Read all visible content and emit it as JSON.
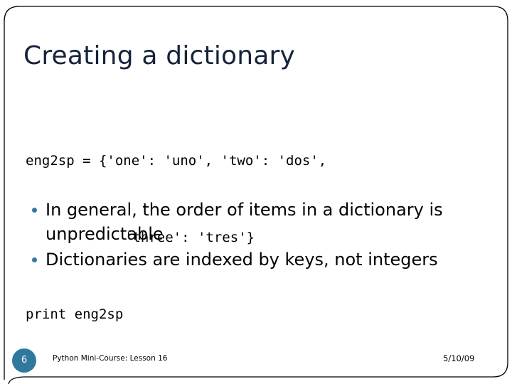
{
  "slide": {
    "title": "Creating a dictionary",
    "code_lines": [
      {
        "text": "eng2sp = {'one': 'uno', 'two': 'dos',",
        "indent": false
      },
      {
        "text": "'three': 'tres'}",
        "indent": true
      },
      {
        "text": "print eng2sp",
        "indent": false
      }
    ],
    "bullets": [
      "In general, the order of items in a dictionary is unpredictable",
      "Dictionaries are indexed by keys, not integers"
    ],
    "footer": {
      "slide_number": "6",
      "course_label": "Python Mini-Course: Lesson 16",
      "date": "5/10/09"
    },
    "colors": {
      "title": "#16233a",
      "accent": "#31789f",
      "body": "#000000",
      "frame": "#000000",
      "background": "#ffffff"
    }
  }
}
